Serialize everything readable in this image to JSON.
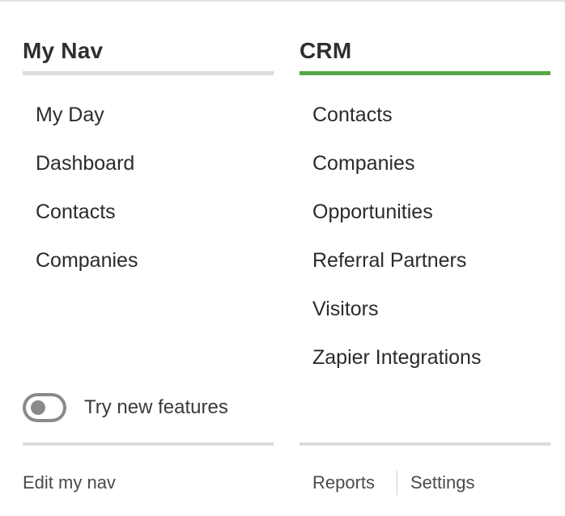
{
  "left": {
    "heading": "My Nav",
    "items": [
      "My Day",
      "Dashboard",
      "Contacts",
      "Companies"
    ]
  },
  "right": {
    "heading": "CRM",
    "items": [
      "Contacts",
      "Companies",
      "Opportunities",
      "Referral Partners",
      "Visitors",
      "Zapier Integrations"
    ]
  },
  "toggle": {
    "label": "Try new features",
    "on": false
  },
  "footer": {
    "edit_nav": "Edit my nav",
    "reports": "Reports",
    "settings": "Settings"
  },
  "colors": {
    "active_tab": "#57a646",
    "inactive_tab": "#dcdcdc"
  }
}
